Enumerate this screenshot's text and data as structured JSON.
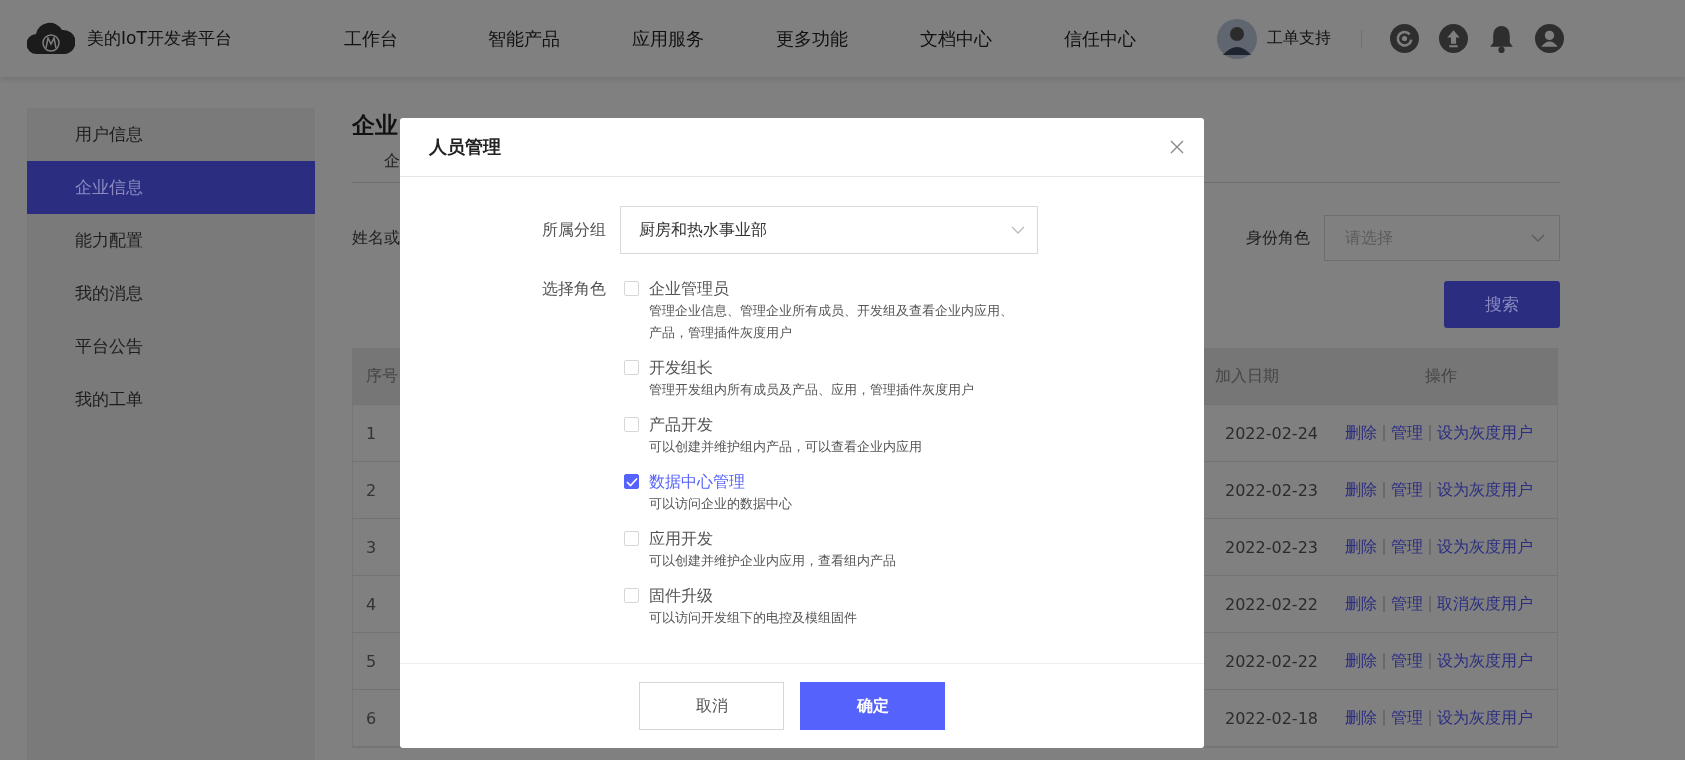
{
  "header": {
    "logo_text": "美的IoT开发者平台",
    "nav": [
      "工作台",
      "智能产品",
      "应用服务",
      "更多功能",
      "文档中心",
      "信任中心"
    ],
    "user_name": "工单支持"
  },
  "sidebar": {
    "items": [
      {
        "label": "用户信息",
        "selected": false
      },
      {
        "label": "企业信息",
        "selected": true
      },
      {
        "label": "能力配置",
        "selected": false
      },
      {
        "label": "我的消息",
        "selected": false
      },
      {
        "label": "平台公告",
        "selected": false
      },
      {
        "label": "我的工单",
        "selected": false
      }
    ]
  },
  "main": {
    "title": "企业",
    "tab": "企",
    "filter_label": "姓名或",
    "role_label": "身份角色",
    "role_placeholder": "请选择",
    "search_button": "搜索",
    "table": {
      "columns": [
        "序号",
        "加入日期",
        "操作"
      ],
      "rows": [
        {
          "index": "1",
          "date": "2022-02-24",
          "actions": [
            "删除",
            "管理",
            "设为灰度用户"
          ]
        },
        {
          "index": "2",
          "date": "2022-02-23",
          "actions": [
            "删除",
            "管理",
            "设为灰度用户"
          ]
        },
        {
          "index": "3",
          "date": "2022-02-23",
          "actions": [
            "删除",
            "管理",
            "设为灰度用户"
          ]
        },
        {
          "index": "4",
          "date": "2022-02-22",
          "actions": [
            "删除",
            "管理",
            "取消灰度用户"
          ]
        },
        {
          "index": "5",
          "date": "2022-02-22",
          "actions": [
            "删除",
            "管理",
            "设为灰度用户"
          ]
        },
        {
          "index": "6",
          "date": "2022-02-18",
          "actions": [
            "删除",
            "管理",
            "设为灰度用户"
          ]
        }
      ]
    }
  },
  "dialog": {
    "title": "人员管理",
    "group_label": "所属分组",
    "group_value": "厨房和热水事业部",
    "role_label": "选择角色",
    "roles": [
      {
        "title": "企业管理员",
        "description": "管理企业信息、管理企业所有成员、开发组及查看企业内应用、产品，管理插件灰度用户",
        "checked": false
      },
      {
        "title": "开发组长",
        "description": "管理开发组内所有成员及产品、应用，管理插件灰度用户",
        "checked": false
      },
      {
        "title": "产品开发",
        "description": "可以创建并维护组内产品，可以查看企业内应用",
        "checked": false
      },
      {
        "title": "数据中心管理",
        "description": "可以访问企业的数据中心",
        "checked": true
      },
      {
        "title": "应用开发",
        "description": "可以创建并维护企业内应用，查看组内产品",
        "checked": false
      },
      {
        "title": "固件升级",
        "description": "可以访问开发组下的电控及模组固件",
        "checked": false
      }
    ],
    "buttons": {
      "cancel": "取消",
      "confirm": "确定"
    }
  }
}
